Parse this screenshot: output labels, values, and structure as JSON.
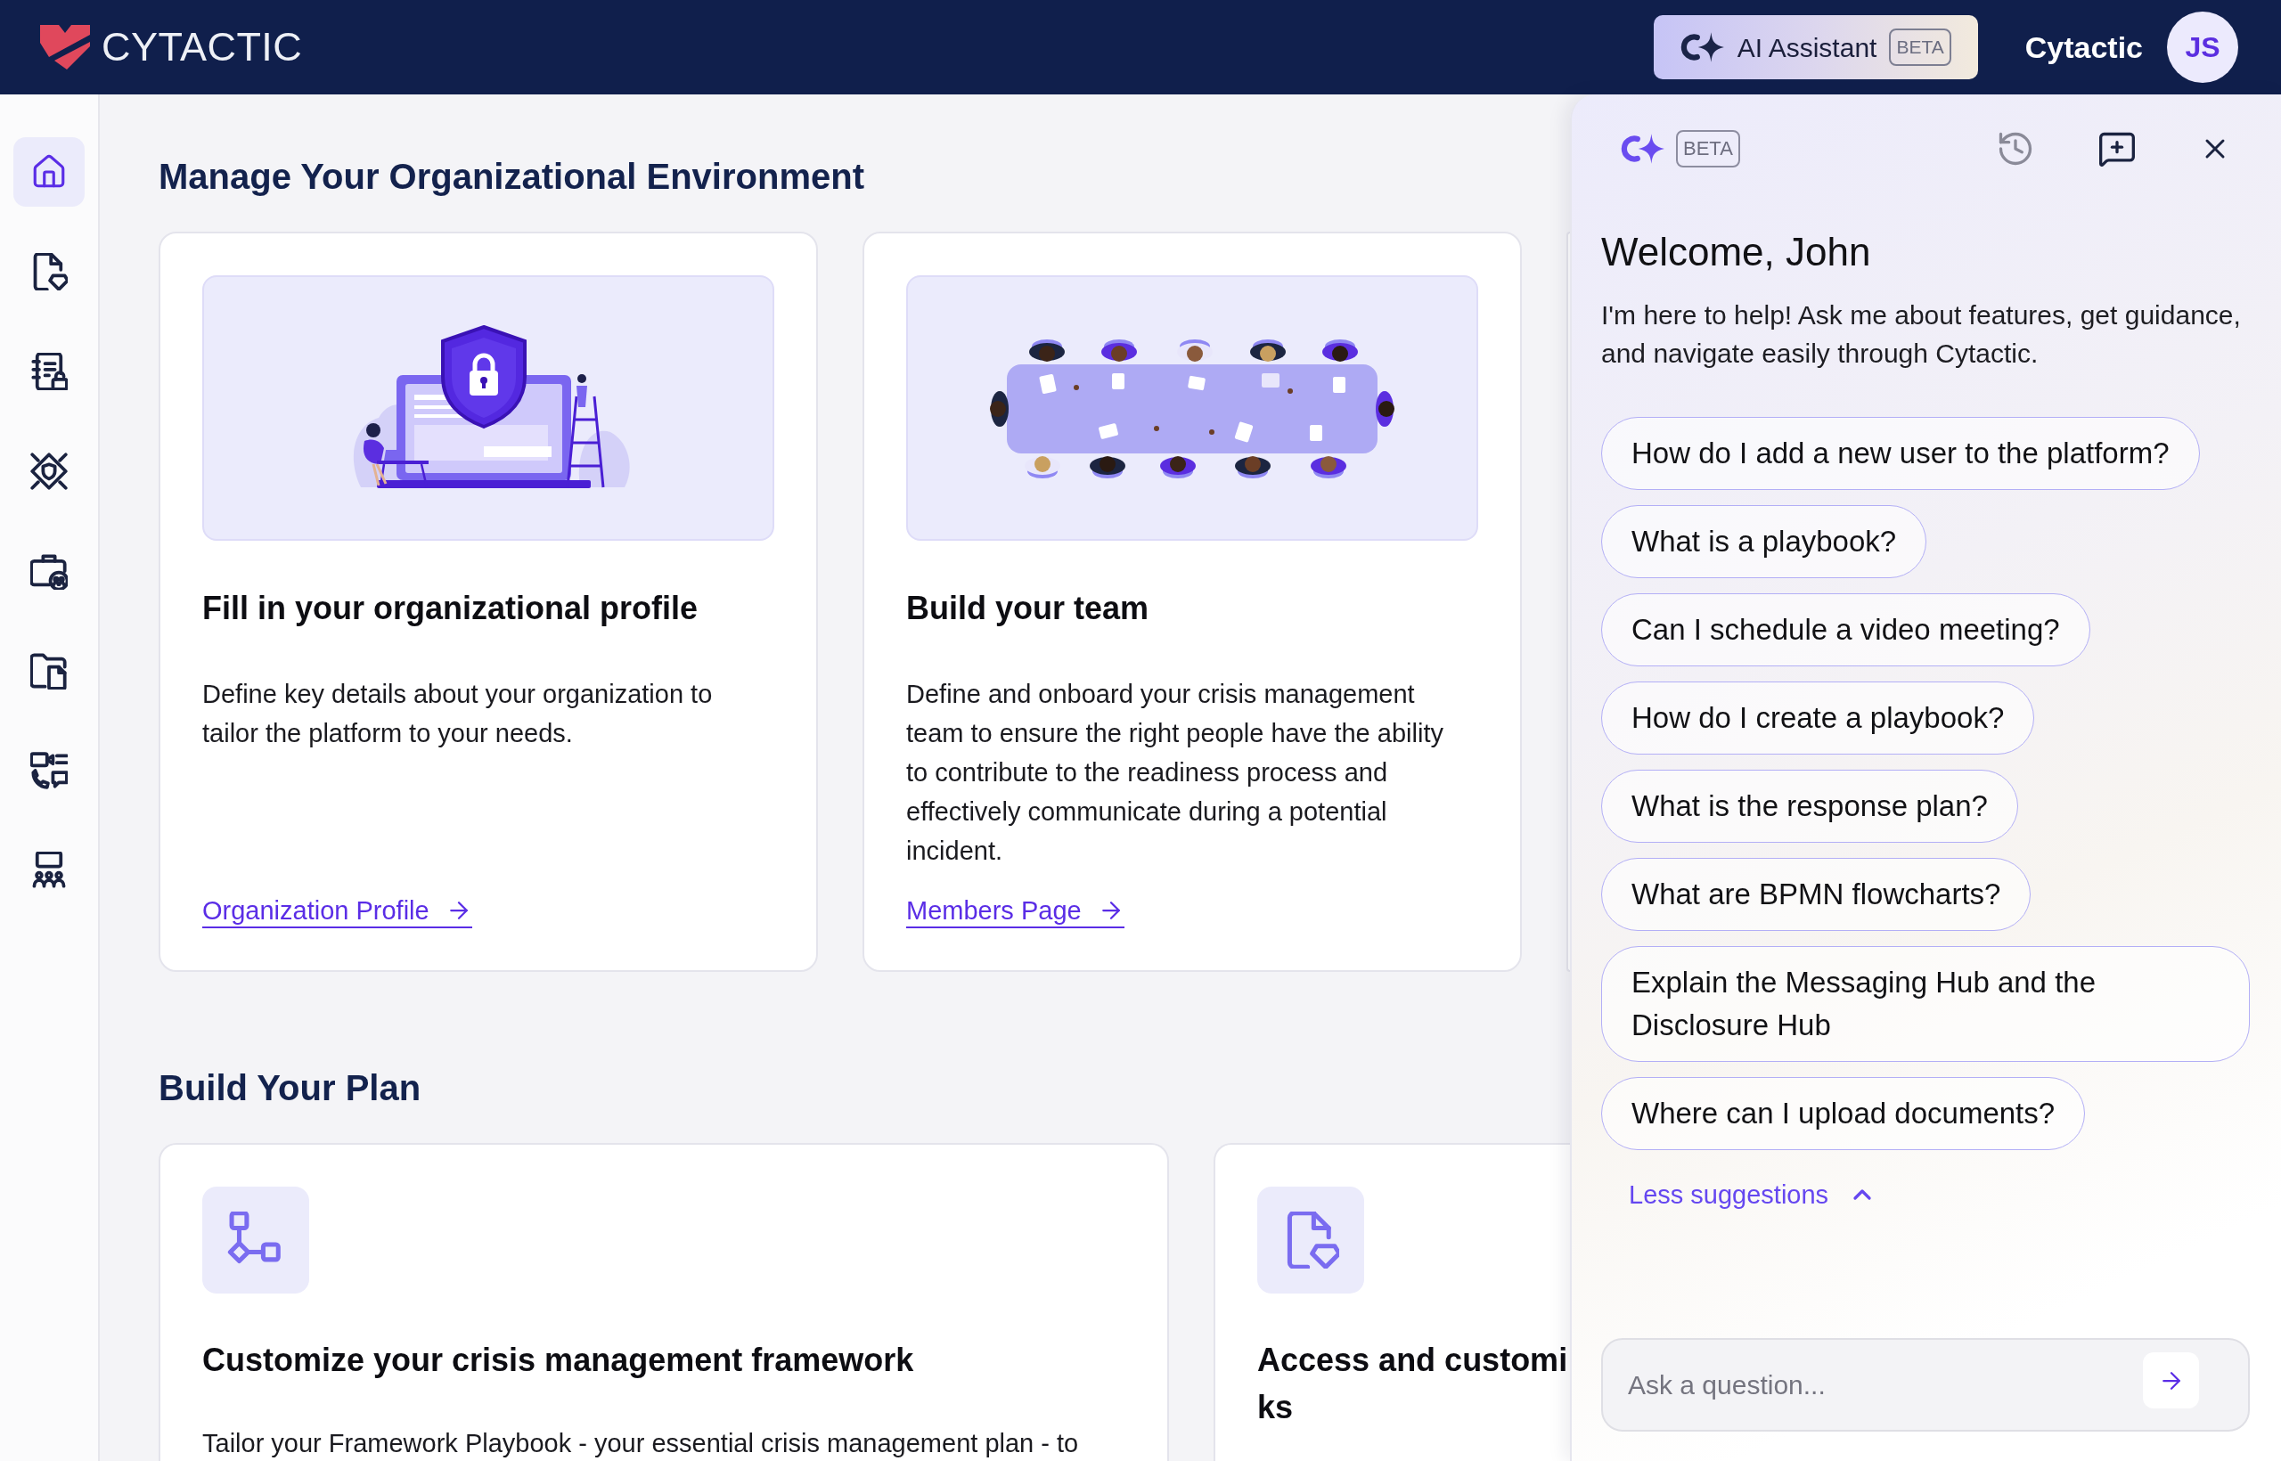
{
  "top_bar": {
    "logo_text": "CYTACTIC",
    "assistant_button": {
      "label": "AI Assistant",
      "badge": "BETA"
    },
    "org_name": "Cytactic",
    "avatar": "JS"
  },
  "sidebar": {
    "items": [
      {
        "selected": true
      },
      {
        "selected": false
      },
      {
        "selected": false
      },
      {
        "selected": false
      },
      {
        "selected": false
      },
      {
        "selected": false
      },
      {
        "selected": false
      },
      {
        "selected": false
      }
    ]
  },
  "sections": [
    {
      "kind": "illustrated",
      "heading": "Manage Your Organizational Environment",
      "cards": [
        {
          "title": "Fill in your organizational profile",
          "description": "Define key details about your organization to tailor the platform to your needs.",
          "link": "Organization Profile"
        },
        {
          "title": "Build your team",
          "description": "Define and onboard your crisis management team to ensure the right people have the ability to contribute to the readiness process and effectively communicate during a potential incident.",
          "link": "Members Page"
        }
      ]
    },
    {
      "kind": "icon",
      "heading": "Build Your Plan",
      "cards": [
        {
          "title_lines": [
            "Customize your crisis management framework"
          ],
          "description": "Tailor your Framework Playbook - your essential crisis management plan - to"
        },
        {
          "title_lines": [
            "Access and customi",
            "ks"
          ]
        }
      ]
    }
  ],
  "assistant_panel": {
    "badge": "BETA",
    "greeting": "Welcome, John",
    "intro": "I'm here to help! Ask me about features, get guidance, and navigate easily through Cytactic.",
    "suggestions": [
      "How do I add a new user to the platform?",
      "What is a playbook?",
      "Can I schedule a video meeting?",
      "How do I create a playbook?",
      "What is the response plan?",
      "What are BPMN flowcharts?",
      "Explain the Messaging Hub and the Disclosure Hub",
      "Where can I upload documents?"
    ],
    "toggle": {
      "label": "Less suggestions",
      "expanded": true
    },
    "input": {
      "placeholder": "Ask a question..."
    }
  }
}
